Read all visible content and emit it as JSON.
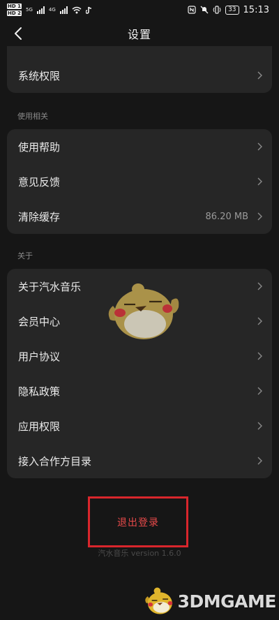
{
  "status_bar": {
    "hd1": "HD 1",
    "hd2": "HD 2",
    "net1": "5G",
    "net2": "4G",
    "battery": "33",
    "time": "15:13"
  },
  "nav": {
    "title": "设置"
  },
  "top_card": {
    "items": [
      {
        "label": "系统权限"
      }
    ]
  },
  "section_usage": {
    "label": "使用相关",
    "items": [
      {
        "label": "使用帮助",
        "value": ""
      },
      {
        "label": "意见反馈",
        "value": ""
      },
      {
        "label": "清除缓存",
        "value": "86.20 MB"
      }
    ]
  },
  "section_about": {
    "label": "关于",
    "items": [
      {
        "label": "关于汽水音乐"
      },
      {
        "label": "会员中心"
      },
      {
        "label": "用户协议"
      },
      {
        "label": "隐私政策"
      },
      {
        "label": "应用权限"
      },
      {
        "label": "接入合作方目录"
      }
    ]
  },
  "logout": {
    "label": "退出登录"
  },
  "version": "汽水音乐 version 1.6.0",
  "watermark": {
    "text": "3DMGAME"
  },
  "colors": {
    "background": "#161616",
    "card": "#262626",
    "logout_text": "#e84a4a",
    "highlight_box": "#d9262c"
  }
}
